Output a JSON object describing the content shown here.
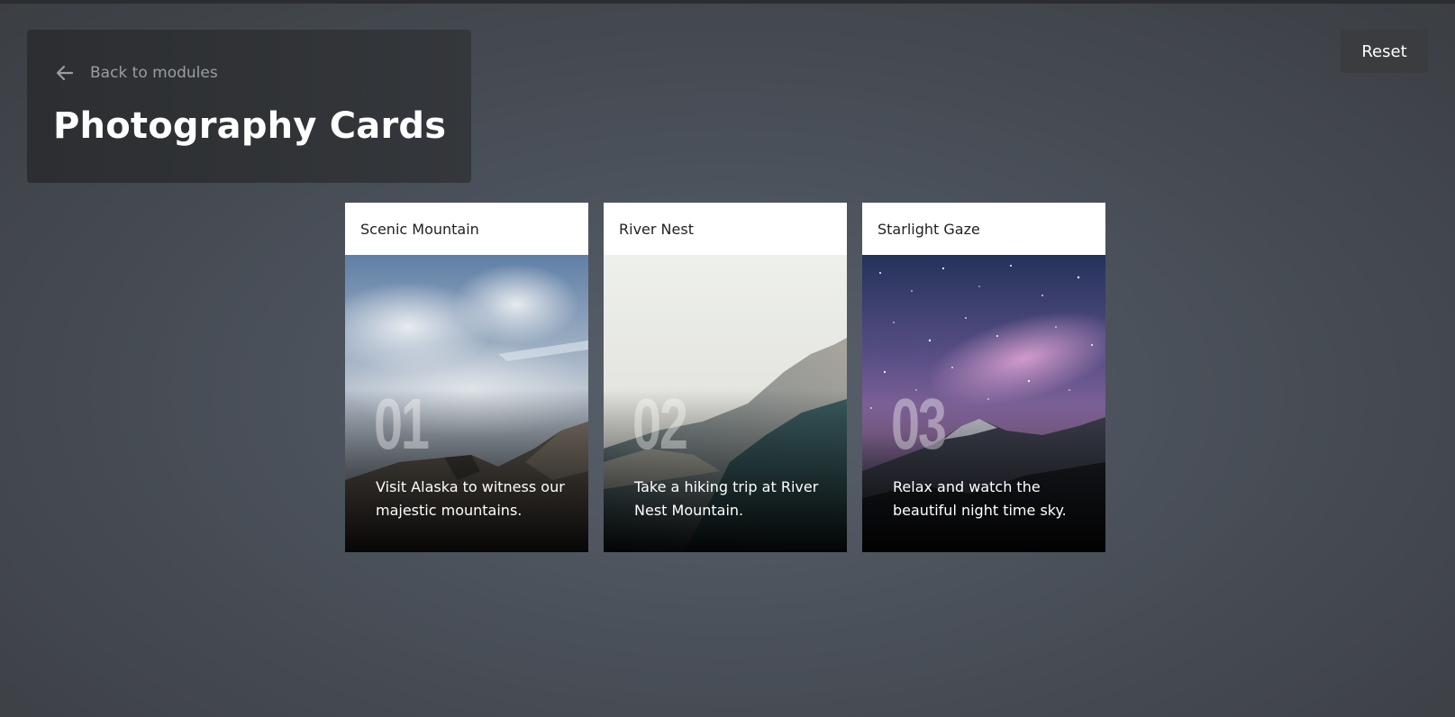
{
  "header": {
    "back_label": "Back to modules",
    "title": "Photography Cards"
  },
  "toolbar": {
    "reset_label": "Reset"
  },
  "cards": [
    {
      "title": "Scenic Mountain",
      "number": "01",
      "description_lines": [
        "Visit Alaska to witness our",
        "majestic mountains."
      ]
    },
    {
      "title": "River Nest",
      "number": "02",
      "description_lines": [
        "Take a hiking trip at River",
        "Nest Mountain."
      ]
    },
    {
      "title": "Starlight Gaze",
      "number": "03",
      "description_lines": [
        "Relax and watch the",
        "beautiful night time sky."
      ]
    }
  ],
  "colors": {
    "background": "#4a5059",
    "header_panel": "#2c2e31",
    "reset_button": "#3a3c3f",
    "card_header": "#ffffff"
  },
  "icons": {
    "back": "arrow-left-icon"
  }
}
